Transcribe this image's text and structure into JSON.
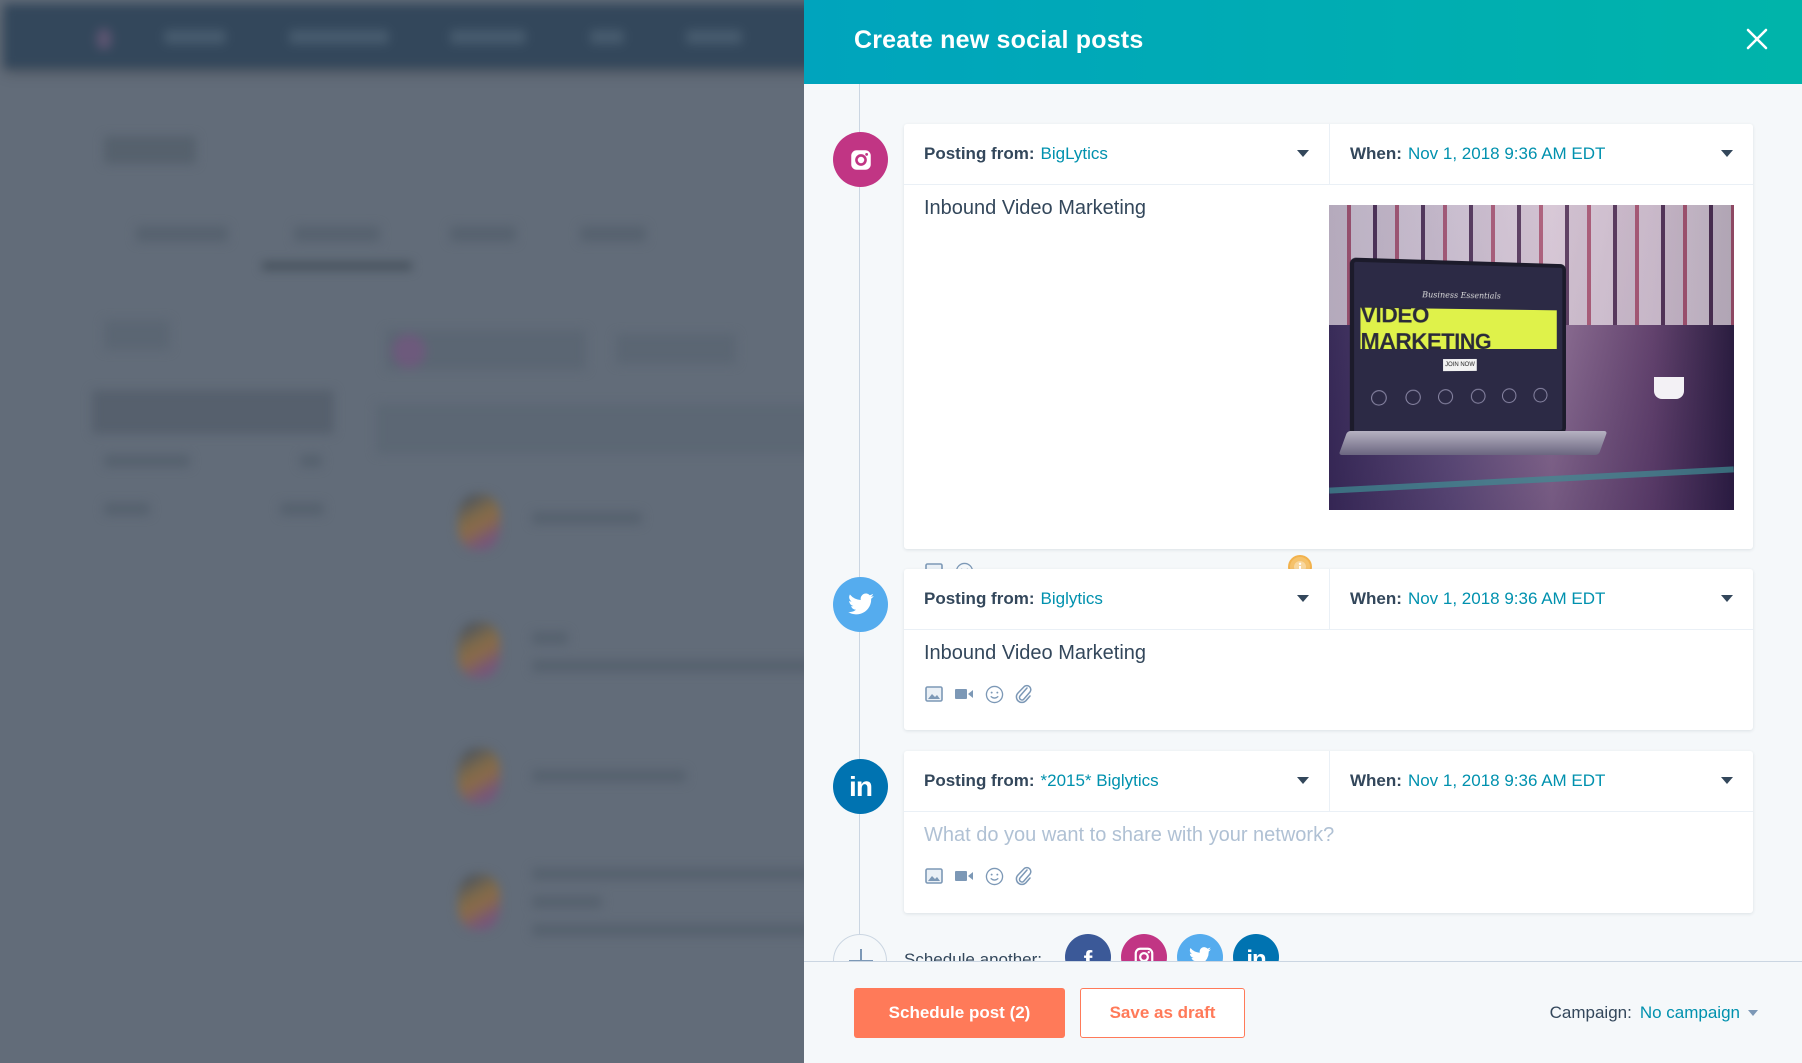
{
  "panel": {
    "title": "Create new social posts",
    "close_icon": "close-icon",
    "accent_gradient": [
      "#00a4bd",
      "#00b4aa"
    ]
  },
  "posts": [
    {
      "network": "instagram",
      "network_icon": "instagram-icon",
      "network_color": "#c13584",
      "posting_from_label": "Posting from:",
      "posting_from_value": "BigLytics",
      "when_label": "When:",
      "when_value": "Nov 1, 2018 9:36 AM EDT",
      "text": "Inbound Video Marketing",
      "placeholder": "",
      "toolbar": [
        "image-icon",
        "emoji-icon"
      ],
      "has_info_icon": true,
      "image": {
        "alt": "Laptop showing Video Marketing website",
        "screen_heading": "VIDEO MARKETING",
        "screen_tagline": "Business Essentials",
        "screen_button": "JOIN NOW"
      }
    },
    {
      "network": "twitter",
      "network_icon": "twitter-icon",
      "network_color": "#55acee",
      "posting_from_label": "Posting from:",
      "posting_from_value": "Biglytics",
      "when_label": "When:",
      "when_value": "Nov 1, 2018 9:36 AM EDT",
      "text": "Inbound Video Marketing",
      "placeholder": "",
      "toolbar": [
        "image-icon",
        "video-icon",
        "emoji-icon",
        "attachment-icon"
      ]
    },
    {
      "network": "linkedin",
      "network_icon": "linkedin-icon",
      "network_color": "#0073b1",
      "posting_from_label": "Posting from:",
      "posting_from_value": "*2015* Biglytics",
      "when_label": "When:",
      "when_value": "Nov 1, 2018 9:36 AM EDT",
      "text": "",
      "placeholder": "What do you want to share with your network?",
      "toolbar": [
        "image-icon",
        "video-icon",
        "emoji-icon",
        "attachment-icon"
      ]
    }
  ],
  "schedule_another": {
    "label": "Schedule another:",
    "networks": [
      {
        "name": "facebook",
        "icon": "facebook-icon",
        "color": "#3b5998"
      },
      {
        "name": "instagram",
        "icon": "instagram-icon",
        "color": "#c13584"
      },
      {
        "name": "twitter",
        "icon": "twitter-icon",
        "color": "#55acee"
      },
      {
        "name": "linkedin",
        "icon": "linkedin-icon",
        "color": "#0073b1"
      }
    ]
  },
  "footer": {
    "schedule_button": "Schedule post (2)",
    "draft_button": "Save as draft",
    "campaign_label": "Campaign:",
    "campaign_value": "No campaign",
    "primary_color": "#ff7a59"
  }
}
